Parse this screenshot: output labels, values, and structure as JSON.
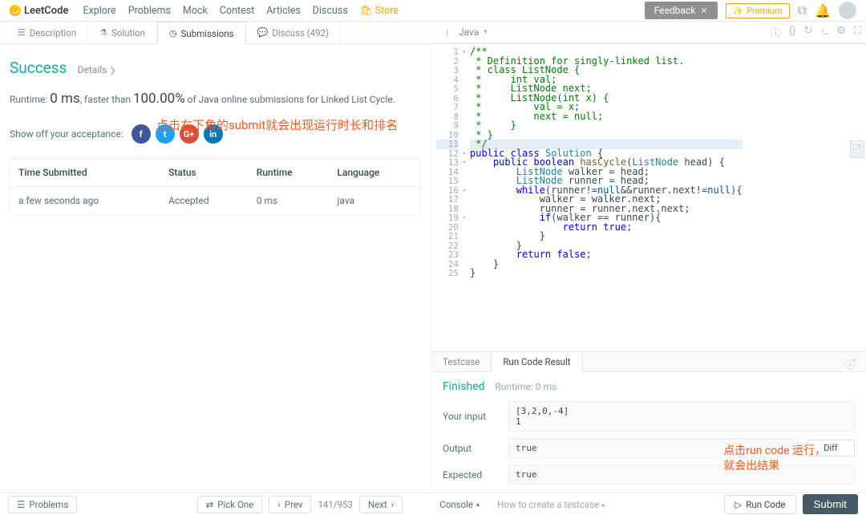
{
  "header": {
    "logo": "LeetCode",
    "nav": [
      "Explore",
      "Problems",
      "Mock",
      "Contest",
      "Articles",
      "Discuss"
    ],
    "store": "Store",
    "feedback": "Feedback",
    "premium": "Premium"
  },
  "tabs": {
    "description": "Description",
    "solution": "Solution",
    "submissions": "Submissions",
    "discuss": "Discuss (492)"
  },
  "lang": {
    "label": "Java"
  },
  "left": {
    "success": "Success",
    "details": "Details",
    "runtime_label": "Runtime:",
    "runtime_val": "0 ms",
    "faster_prefix": ", faster than ",
    "faster_pct": "100.00%",
    "faster_suffix": " of Java online submissions for Linked List Cycle.",
    "showoff": "Show off your acceptance:",
    "annotation1": "点击右下角的submit就会出现运行时长和排名",
    "table": {
      "h1": "Time Submitted",
      "h2": "Status",
      "h3": "Runtime",
      "h4": "Language",
      "r1c1": "a few seconds ago",
      "r1c2": "Accepted",
      "r1c3": "0 ms",
      "r1c4": "java"
    }
  },
  "code": {
    "lines": [
      "/**",
      " * Definition for singly-linked list.",
      " * class ListNode {",
      " *     int val;",
      " *     ListNode next;",
      " *     ListNode(int x) {",
      " *         val = x;",
      " *         next = null;",
      " *     }",
      " * }",
      " */",
      "public class Solution {",
      "    public boolean hasCycle(ListNode head) {",
      "        ListNode walker = head;",
      "        ListNode runner = head;",
      "        while(runner!=null&&runner.next!=null){",
      "            walker = walker.next;",
      "            runner = runner.next.next;",
      "            if(walker == runner){",
      "                return true;",
      "            }",
      "        }",
      "        return false;",
      "    }",
      "}"
    ]
  },
  "tr": {
    "testcase": "Testcase",
    "runcode": "Run Code Result",
    "finished": "Finished",
    "runtime": "Runtime: 0 ms",
    "your_input": "Your input",
    "input_val": "[3,2,0,-4]\n1",
    "output": "Output",
    "output_val": "true",
    "expected": "Expected",
    "expected_val": "true",
    "diff": "Diff"
  },
  "bottom": {
    "problems": "Problems",
    "pickone": "Pick One",
    "prev": "Prev",
    "count": "141/953",
    "next": "Next",
    "console": "Console",
    "howto": "How to create a testcase",
    "runcode": "Run Code",
    "submit": "Submit"
  },
  "annotation2": "点击run code 运行，\n就会出结果"
}
